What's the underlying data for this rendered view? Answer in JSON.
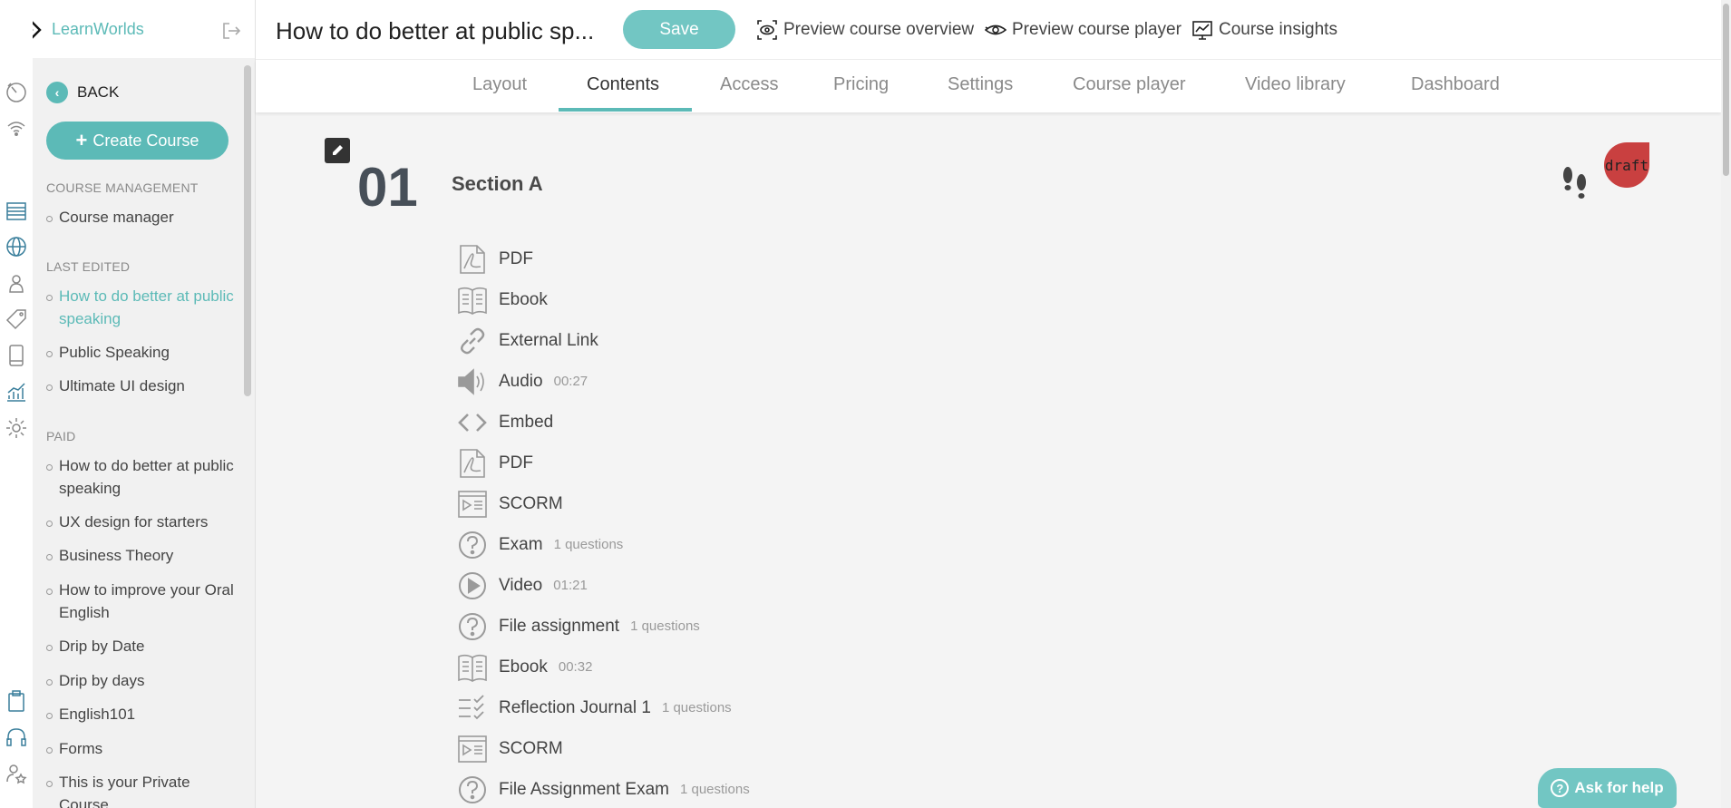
{
  "app": {
    "name": "LearnWorlds"
  },
  "sidebar": {
    "back_label": "BACK",
    "create_label": "Create Course",
    "sections": [
      {
        "heading": "COURSE MANAGEMENT",
        "items": [
          "Course manager"
        ]
      },
      {
        "heading": "LAST EDITED",
        "items": [
          "How to do better at public speaking",
          "Public Speaking",
          "Ultimate UI design"
        ]
      },
      {
        "heading": "PAID",
        "items": [
          "How to do better at public speaking",
          "UX design for starters",
          "Business Theory",
          "How to improve your Oral English",
          "Drip by Date",
          "Drip by days",
          "English101",
          "Forms",
          "This is your Private Course"
        ]
      }
    ]
  },
  "header": {
    "title": "How to do better at public sp...",
    "save_label": "Save",
    "links": [
      "Preview course overview",
      "Preview course player",
      "Course insights"
    ]
  },
  "tabs": {
    "items": [
      "Layout",
      "Contents",
      "Access",
      "Pricing",
      "Settings",
      "Course player",
      "Video library",
      "Dashboard"
    ],
    "active": "Contents"
  },
  "section": {
    "number": "01",
    "title": "Section A",
    "badge": "draft",
    "lessons": [
      {
        "type": "pdf-icon",
        "name": "PDF",
        "meta": ""
      },
      {
        "type": "ebook-icon",
        "name": "Ebook",
        "meta": ""
      },
      {
        "type": "link-icon",
        "name": "External Link",
        "meta": ""
      },
      {
        "type": "audio-icon",
        "name": "Audio",
        "meta": "00:27"
      },
      {
        "type": "embed-icon",
        "name": "Embed",
        "meta": ""
      },
      {
        "type": "pdf-icon",
        "name": "PDF",
        "meta": ""
      },
      {
        "type": "scorm-icon",
        "name": "SCORM",
        "meta": ""
      },
      {
        "type": "question-icon",
        "name": "Exam",
        "meta": "1 questions"
      },
      {
        "type": "video-icon",
        "name": "Video",
        "meta": "01:21"
      },
      {
        "type": "question-icon",
        "name": "File assignment",
        "meta": "1 questions"
      },
      {
        "type": "ebook-icon",
        "name": "Ebook",
        "meta": "00:32"
      },
      {
        "type": "checklist-icon",
        "name": "Reflection Journal 1",
        "meta": "1 questions"
      },
      {
        "type": "scorm-icon",
        "name": "SCORM",
        "meta": ""
      },
      {
        "type": "question-icon",
        "name": "File Assignment Exam",
        "meta": "1 questions"
      }
    ]
  },
  "help": {
    "label": "Ask for help"
  },
  "colors": {
    "accent": "#5cbab7",
    "draft": "#c94040"
  }
}
